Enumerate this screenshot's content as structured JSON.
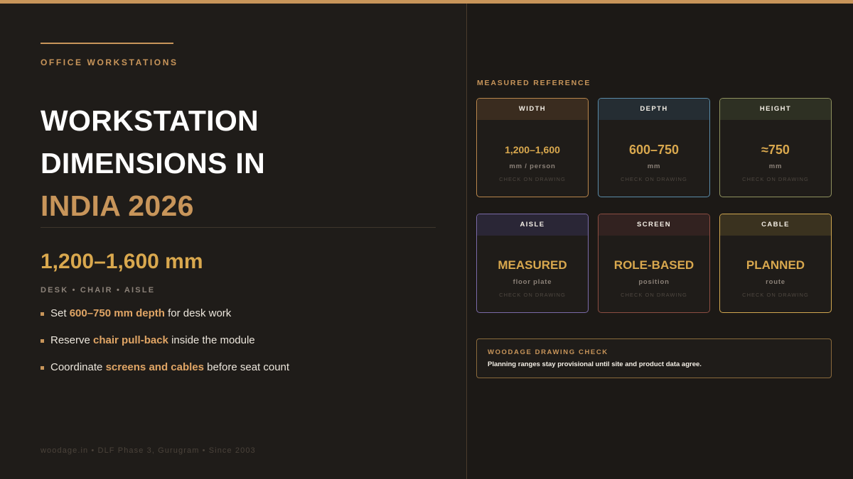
{
  "eyebrow": "OFFICE WORKSTATIONS",
  "title": {
    "line1": "WORKSTATION",
    "line2": "DIMENSIONS IN",
    "line3": "INDIA 2026"
  },
  "summary": {
    "value": "1,200–1,600 mm",
    "tagline": "DESK • CHAIR • AISLE"
  },
  "bullets": [
    {
      "pre": "Set ",
      "em": "600–750 mm depth",
      "post": " for desk work"
    },
    {
      "pre": "Reserve ",
      "em": "chair pull-back",
      "post": " inside the module"
    },
    {
      "pre": "Coordinate ",
      "em": "screens and cables",
      "post": " before seat count"
    }
  ],
  "footer": "woodage.in • DLF Phase 3, Gurugram • Since 2003",
  "reference": {
    "label": "MEASURED REFERENCE",
    "cards": [
      {
        "head": "WIDTH",
        "value": "1,200–1,600",
        "unit": "mm / person",
        "check": "CHECK ON DRAWING",
        "border": "#b8864c",
        "head_bg": "#3a2c1f"
      },
      {
        "head": "DEPTH",
        "value": "600–750",
        "unit": "mm",
        "check": "CHECK ON DRAWING",
        "border": "#5a8ba8",
        "head_bg": "#252d33"
      },
      {
        "head": "HEIGHT",
        "value": "≈750",
        "unit": "mm",
        "check": "CHECK ON DRAWING",
        "border": "#8f915e",
        "head_bg": "#2e3023"
      },
      {
        "head": "AISLE",
        "value": "MEASURED",
        "unit": "floor plate",
        "check": "CHECK ON DRAWING",
        "border": "#7a6aa8",
        "head_bg": "#2a2636"
      },
      {
        "head": "SCREEN",
        "value": "ROLE-BASED",
        "unit": "position",
        "check": "CHECK ON DRAWING",
        "border": "#8c4d42",
        "head_bg": "#322220"
      },
      {
        "head": "CABLE",
        "value": "PLANNED",
        "unit": "route",
        "check": "CHECK ON DRAWING",
        "border": "#d0a750",
        "head_bg": "#3a321f"
      }
    ]
  },
  "note": {
    "title": "WOODAGE DRAWING CHECK",
    "body": "Planning ranges stay provisional until site and product data agree."
  },
  "colors": {
    "accent": "#c8955a",
    "value_gold": "#d9a84e",
    "background": "#1f1c19"
  }
}
